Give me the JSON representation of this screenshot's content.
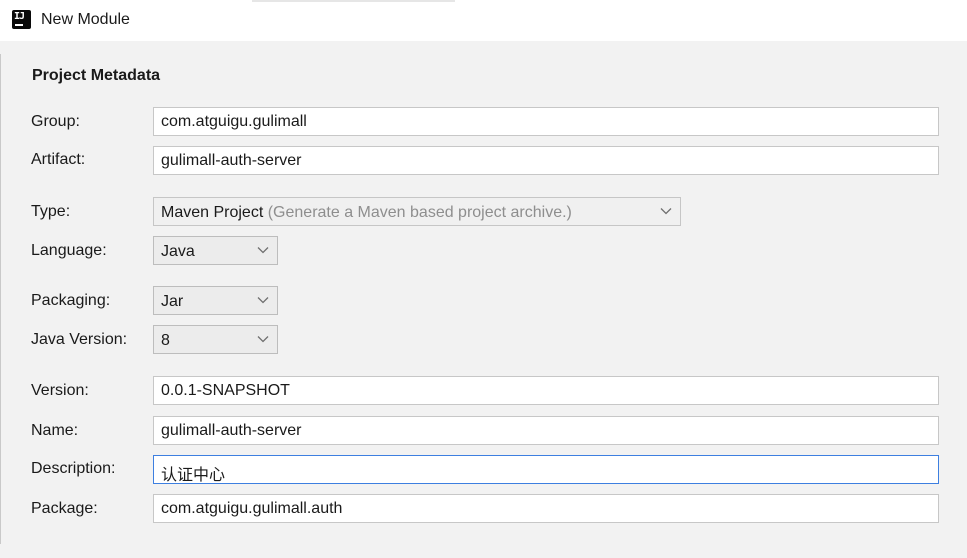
{
  "window": {
    "title": "New Module",
    "icon": "intellij-idea-icon"
  },
  "section": {
    "title": "Project Metadata"
  },
  "fields": {
    "group": {
      "label": "Group:",
      "value": "com.atguigu.gulimall"
    },
    "artifact": {
      "label": "Artifact:",
      "value": "gulimall-auth-server"
    },
    "type": {
      "label": "Type:",
      "value": "Maven Project",
      "hint": "(Generate a Maven based project archive.)"
    },
    "language": {
      "label": "Language:",
      "value": "Java"
    },
    "packaging": {
      "label": "Packaging:",
      "value": "Jar"
    },
    "java_version": {
      "label": "Java Version:",
      "value": "8"
    },
    "version": {
      "label": "Version:",
      "value": "0.0.1-SNAPSHOT"
    },
    "name": {
      "label": "Name:",
      "value": "gulimall-auth-server"
    },
    "description": {
      "label": "Description:",
      "value": "认证中心"
    },
    "package": {
      "label": "Package:",
      "value": "com.atguigu.gulimall.auth"
    }
  },
  "colors": {
    "focus_border": "#3d7fe0",
    "background": "#f2f2f2"
  }
}
